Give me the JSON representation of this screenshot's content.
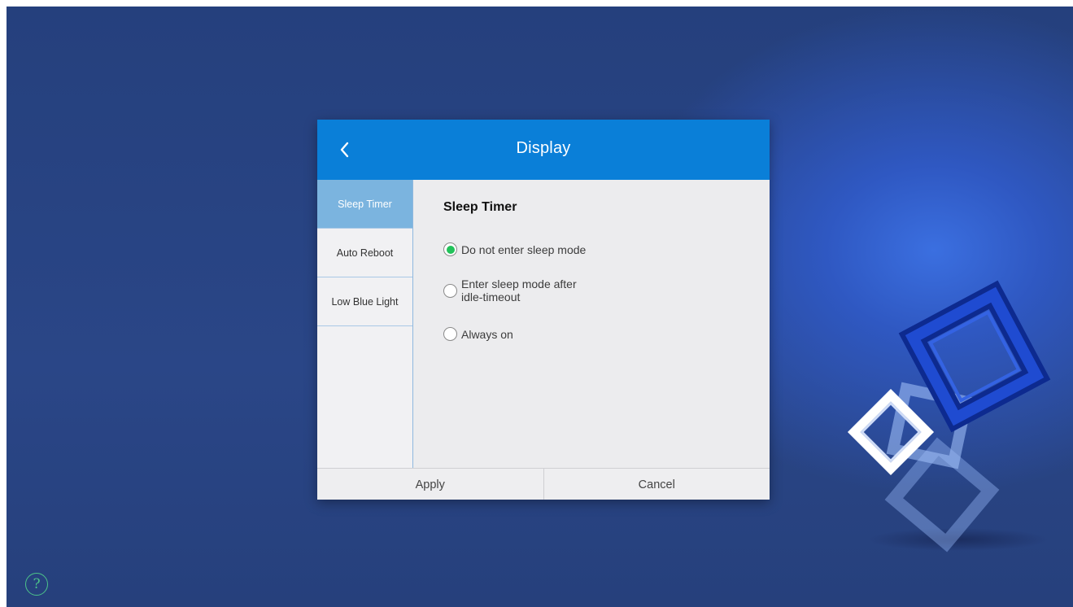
{
  "dialog": {
    "title": "Display",
    "back_icon": "chevron-left-icon"
  },
  "sidebar": {
    "items": [
      {
        "label": "Sleep Timer",
        "active": true
      },
      {
        "label": "Auto Reboot",
        "active": false
      },
      {
        "label": "Low Blue Light",
        "active": false
      }
    ]
  },
  "content": {
    "section_title": "Sleep Timer",
    "options": [
      {
        "label": "Do not enter sleep mode",
        "checked": true
      },
      {
        "label": "Enter sleep mode after idle-timeout",
        "checked": false
      },
      {
        "label": "Always on",
        "checked": false
      }
    ]
  },
  "footer": {
    "apply_label": "Apply",
    "cancel_label": "Cancel"
  },
  "help": {
    "icon": "help-icon",
    "glyph": "?"
  },
  "colors": {
    "header": "#0a7fd8",
    "active_tab": "#7bb4df",
    "radio_selected": "#22c25a",
    "help_accent": "#4cc38a"
  }
}
